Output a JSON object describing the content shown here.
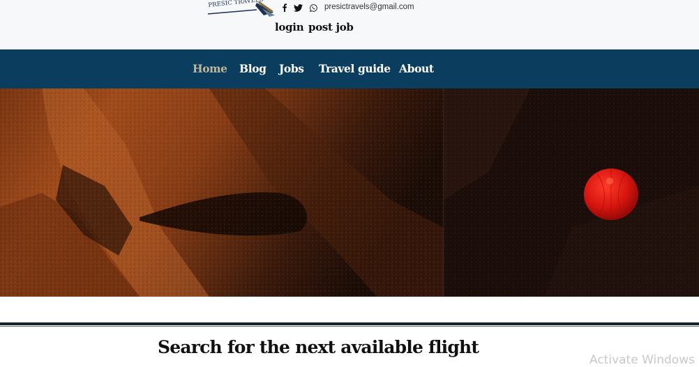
{
  "header": {
    "logo_text": "PRESIC TRAVELS",
    "social_icons": [
      "facebook-icon",
      "twitter-icon",
      "whatsapp-icon"
    ],
    "email": "presictravels@gmail.com",
    "login_label": "login",
    "post_job_label": "post job"
  },
  "nav": {
    "items": [
      {
        "label": "Home",
        "active": true
      },
      {
        "label": "Blog",
        "active": false
      },
      {
        "label": "Jobs",
        "active": false
      },
      {
        "label": "Travel guide",
        "active": false
      },
      {
        "label": "About",
        "active": false
      }
    ]
  },
  "main": {
    "search_heading": "Search for the next available flight"
  },
  "overlay": {
    "watermark": "Activate Windows"
  },
  "colors": {
    "navbar_bg": "#0b3d5e",
    "nav_active": "#bdb89c",
    "header_bg": "#f6f8fa"
  }
}
